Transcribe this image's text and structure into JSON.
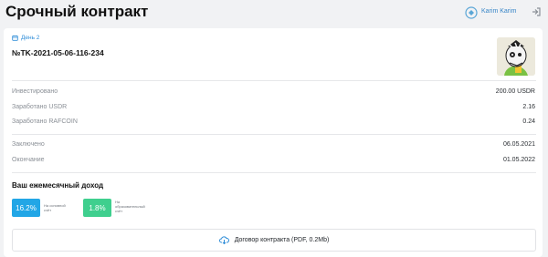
{
  "header": {
    "title": "Срочный контракт",
    "brand_caption": "",
    "user_name": "Karim Karim"
  },
  "contract": {
    "day_badge": "День 2",
    "number": "№TK-2021-05-06-116-234"
  },
  "details": {
    "rows": [
      {
        "label": "Инвестировано",
        "value": "200.00 USDR"
      },
      {
        "label": "Заработано USDR",
        "value": "2.16"
      },
      {
        "label": "Заработано RAFCOIN",
        "value": "0.24"
      },
      {
        "label": "Заключено",
        "value": "06.05.2021"
      },
      {
        "label": "Окончание",
        "value": "01.05.2022"
      }
    ]
  },
  "income": {
    "title": "Ваш ежемесячный доход",
    "main": {
      "value": "16.2%",
      "caption_1": "На основной",
      "caption_2": "счёт",
      "color": "#22a6e6"
    },
    "edu": {
      "value": "1.8%",
      "caption_1": "На",
      "caption_2": "образовательный",
      "caption_3": "счёт",
      "color": "#3fcf8e"
    }
  },
  "download": {
    "label": "Договор контракта (PDF, 0.2Mb)",
    "icon": "cloud-download-icon"
  },
  "colors": {
    "accent": "#2f8dd8",
    "background": "#f1f2f4"
  }
}
